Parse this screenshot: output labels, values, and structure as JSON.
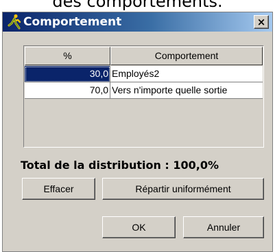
{
  "caption": "des comportements.",
  "dialog": {
    "title": "Comportement",
    "close_label": "×"
  },
  "table": {
    "columns": [
      "%",
      "Comportement"
    ],
    "rows": [
      {
        "percent": "30,0",
        "behavior": "Employés2"
      },
      {
        "percent": "70,0",
        "behavior": "Vers n'importe quelle sortie"
      }
    ]
  },
  "total_label": "Total de la distribution : 100,0%",
  "buttons": {
    "clear": "Effacer",
    "spread": "Répartir uniformément",
    "ok": "OK",
    "cancel": "Annuler"
  },
  "colors": {
    "title_bar_start": "#0a246a",
    "title_bar_end": "#a6caf0",
    "selection": "#0a246a",
    "icon": "#2e8b2e"
  },
  "icons": {
    "title": "running-person-icon"
  }
}
